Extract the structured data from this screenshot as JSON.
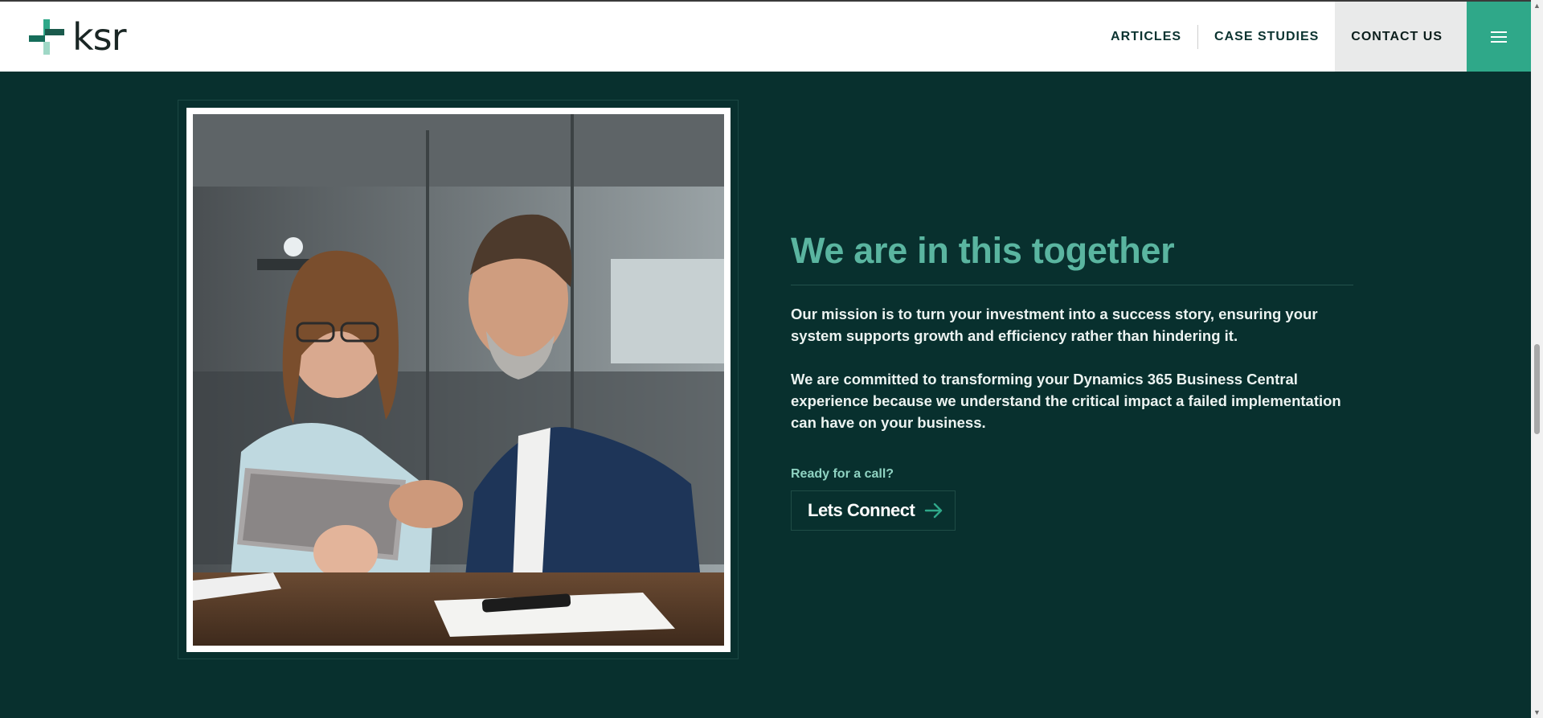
{
  "header": {
    "logo_text": "ksr",
    "nav": [
      {
        "label": "ARTICLES"
      },
      {
        "label": "CASE STUDIES"
      },
      {
        "label": "CONTACT US"
      }
    ],
    "menu_icon": "hamburger-menu-icon"
  },
  "section": {
    "image_alt": "Two colleagues reviewing a tablet at an office desk",
    "headline": "We are in this together",
    "paragraphs": [
      "Our mission is to turn your investment into a success story, ensuring your system supports growth and efficiency rather than hindering it.",
      "We are committed to transforming your Dynamics 365 Business Central experience because we understand the critical impact a failed implementation can have on your business."
    ],
    "cta_label": "Ready for a call?",
    "cta_button": "Lets Connect",
    "cta_icon": "arrow-right-icon"
  },
  "colors": {
    "background": "#08302e",
    "accent": "#2fa889",
    "headline": "#5ab5a0"
  }
}
